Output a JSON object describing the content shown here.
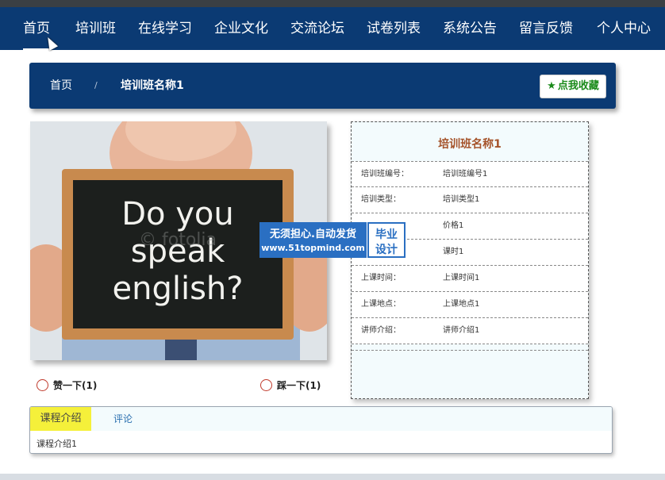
{
  "nav": {
    "items": [
      {
        "label": "首页"
      },
      {
        "label": "培训班"
      },
      {
        "label": "在线学习"
      },
      {
        "label": "企业文化"
      },
      {
        "label": "交流论坛"
      },
      {
        "label": "试卷列表"
      },
      {
        "label": "系统公告"
      },
      {
        "label": "留言反馈"
      },
      {
        "label": "个人中心"
      }
    ]
  },
  "breadcrumb": {
    "home": "首页",
    "separator": "/",
    "current": "培训班名称1"
  },
  "favorite": {
    "label": "点我收藏",
    "icon": "star-icon"
  },
  "photo": {
    "line1": "Do you",
    "line2": "speak",
    "line3": "english?",
    "watermark": "© fotolia"
  },
  "votes": {
    "like": "赞一下(1)",
    "dislike": "踩一下(1)"
  },
  "info": {
    "title": "培训班名称1",
    "rows": [
      {
        "label": "培训班编号：",
        "value": "培训班编号1"
      },
      {
        "label": "培训类型：",
        "value": "培训类型1"
      },
      {
        "label": "",
        "value": "价格1"
      },
      {
        "label": "",
        "value": "课时1"
      },
      {
        "label": "上课时间：",
        "value": "上课时间1"
      },
      {
        "label": "上课地点：",
        "value": "上课地点1"
      },
      {
        "label": "讲师介绍：",
        "value": "讲师介绍1"
      }
    ]
  },
  "overlay": {
    "line1": "无须担心.自动发货",
    "line2": "www.51topmind.com",
    "right1": "毕业",
    "right2": "设计"
  },
  "tabs": {
    "items": [
      {
        "label": "课程介绍"
      },
      {
        "label": "评论"
      }
    ],
    "content": "课程介绍1"
  },
  "colors": {
    "nav_bg": "#0b3a73",
    "accent_title": "#a5532a",
    "fav_green": "#1a8a1a",
    "tab_active": "#f5f03a"
  }
}
